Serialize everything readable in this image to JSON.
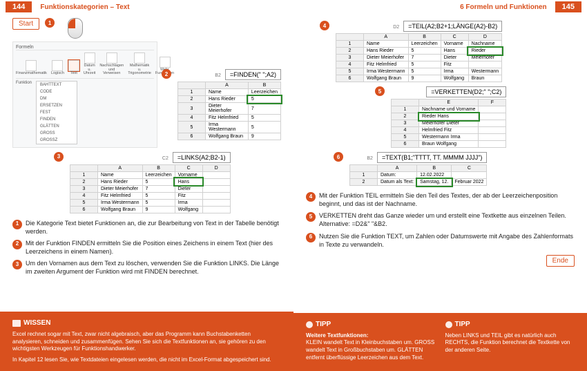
{
  "left": {
    "pgnum": "144",
    "title": "Funktionskategorien – Text",
    "start": "Start",
    "ribbon_tab": "Formeln",
    "ribbon_items": [
      "Finanzmathematik",
      "Logisch",
      "Text",
      "Datum u. Uhrzeit",
      "Nachschlagen und Verweisen",
      "Mathematik u. Trigonometrie",
      "Mehr Funktionen"
    ],
    "ribbon_label": "Funktion",
    "menu": [
      "BAHTTEXT",
      "CODE",
      "DM",
      "ERSETZEN",
      "FEST",
      "FINDEN",
      "GLÄTTEN",
      "GROSS",
      "GROSSZ"
    ],
    "fig2": {
      "formula": "=FINDEN(\" \";A2)",
      "cols": [
        "",
        "A",
        "B"
      ],
      "rows": [
        [
          "1",
          "Name",
          "Leerzeichen"
        ],
        [
          "2",
          "Hans Rieder",
          "5"
        ],
        [
          "3",
          "Dieter Meierhofer",
          "7"
        ],
        [
          "4",
          "Fitz Helmfried",
          "5"
        ],
        [
          "5",
          "Irma Westermann",
          "5"
        ],
        [
          "6",
          "Wolfgang Braun",
          "9"
        ]
      ],
      "cell": "B2"
    },
    "fig3": {
      "formula": "=LINKS(A2;B2-1)",
      "cols": [
        "",
        "A",
        "B",
        "C",
        "D"
      ],
      "rows": [
        [
          "1",
          "Name",
          "Leerzeichen",
          "Vorname",
          ""
        ],
        [
          "2",
          "Hans Rieder",
          "5",
          "Hans",
          ""
        ],
        [
          "3",
          "Dieter Meierhofer",
          "7",
          "Dieter",
          ""
        ],
        [
          "4",
          "Fitz Helmfried",
          "5",
          "Fitz",
          ""
        ],
        [
          "5",
          "Irma Westermann",
          "5",
          "Irma",
          ""
        ],
        [
          "6",
          "Wolfgang Braun",
          "9",
          "Wolfgang",
          ""
        ]
      ],
      "cell": "C2"
    },
    "desc": [
      "Die Kategorie Text bietet Funktionen an, die zur Bearbeitung von Text in der Tabelle benötigt werden.",
      "Mit der Funktion FINDEN ermitteln Sie die Position eines Zeichens in einem Text (hier des Leerzeichens in einem Namen).",
      "Um den Vornamen aus dem Text zu löschen, verwenden Sie die Funktion LINKS. Die Länge im zweiten Argument der Funktion wird mit FINDEN berechnet."
    ],
    "wissen_title": "WISSEN",
    "wissen_text1": "Excel rechnet sogar mit Text, zwar nicht algebraisch, aber das Programm kann Buchstabenketten analysieren, schneiden und zusammenfügen. Sehen Sie sich die Textfunktionen an, sie gehören zu den wichtigsten Werkzeugen für Funktionshandwerker.",
    "wissen_text2": "In Kapitel 12 lesen Sie, wie Textdateien eingelesen werden, die nicht im Excel-Format abgespeichert sind."
  },
  "right": {
    "pgnum": "145",
    "title": "6   Formeln und Funktionen",
    "ende": "Ende",
    "fig4": {
      "formula": "=TEIL(A2;B2+1;LÄNGE(A2)-B2)",
      "cols": [
        "",
        "A",
        "B",
        "C",
        "D"
      ],
      "rows": [
        [
          "1",
          "Name",
          "Leerzeichen",
          "Vorname",
          "Nachname"
        ],
        [
          "2",
          "Hans Rieder",
          "5",
          "Hans",
          "Rieder"
        ],
        [
          "3",
          "Dieter Meierhofer",
          "7",
          "Dieter",
          "Meierhofer"
        ],
        [
          "4",
          "Fitz Helmfried",
          "5",
          "Fitz",
          ""
        ],
        [
          "5",
          "Irma Westermann",
          "5",
          "Irma",
          "Westermann"
        ],
        [
          "6",
          "Wolfgang Braun",
          "9",
          "Wolfgang",
          "Braun"
        ]
      ],
      "cell": "D2"
    },
    "fig5": {
      "formula": "=VERKETTEN(D2;\" \";C2)",
      "cols": [
        "",
        "E",
        "F"
      ],
      "rows": [
        [
          "1",
          "Nachname und Vorname",
          ""
        ],
        [
          "2",
          "Rieder Hans",
          ""
        ],
        [
          "3",
          "Meierhofer Dieter",
          ""
        ],
        [
          "4",
          "Helmfried Fitz",
          ""
        ],
        [
          "5",
          "Westermann Irma",
          ""
        ],
        [
          "6",
          "Braun Wolfgang",
          ""
        ]
      ],
      "cell": "E2"
    },
    "fig6": {
      "formula": "=TEXT(B1;\"TTTT, TT. MMMM JJJJ\")",
      "cols": [
        "",
        "A",
        "B",
        "C"
      ],
      "rows": [
        [
          "1",
          "Datum:",
          "12.02.2022",
          ""
        ],
        [
          "2",
          "Datum als Text:",
          "Samstag, 12.",
          "Februar 2022"
        ]
      ],
      "cell": "B2"
    },
    "desc": [
      "Mit der Funktion TEIL ermitteln Sie den Teil des Textes, der ab der Leerzeichenposition beginnt, und das ist der Nachname.",
      "VERKETTEN dreht das Ganze wieder um und erstellt eine Textkette aus einzelnen Teilen. Alternative: =D2&\" \"&B2.",
      "Nutzen Sie die Funktion TEXT, um Zahlen oder Datumswerte mit Angabe des Zahlenformats in Texte zu verwandeln."
    ],
    "tipp_title": "TIPP",
    "tipp1_head": "Weitere Textfunktionen:",
    "tipp1_text": "KLEIN wandelt Text in Kleinbuchstaben um. GROSS wandelt Text in Großbuchstaben um. GLÄTTEN entfernt überflüssige Leerzeichen aus dem Text.",
    "tipp2_text": "Neben LINKS und TEIL gibt es natürlich auch RECHTS, die Funktion berechnet die Textkette von der anderen Seite."
  }
}
